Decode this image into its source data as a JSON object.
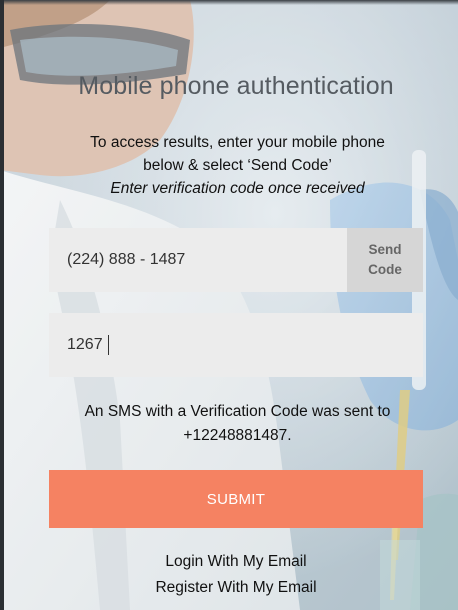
{
  "title": "Mobile phone authentication",
  "intro": {
    "line1": "To access results, enter your mobile phone",
    "line2": "below & select ‘Send Code’",
    "line3": "Enter verification code once received"
  },
  "phone": {
    "value": "(224) 888 - 1487"
  },
  "send_code": {
    "line1": "Send",
    "line2": "Code"
  },
  "code": {
    "value": "1267"
  },
  "sms_message": {
    "line1": "An SMS with a Verification Code was sent to",
    "line2": "+12248881487."
  },
  "submit_label": "SUBMIT",
  "links": {
    "login_email": "Login With My Email",
    "register_email": "Register With My Email"
  },
  "colors": {
    "submit": "#f58262",
    "field": "#ececec",
    "send_code": "#d6d6d6",
    "title": "#555b61"
  }
}
